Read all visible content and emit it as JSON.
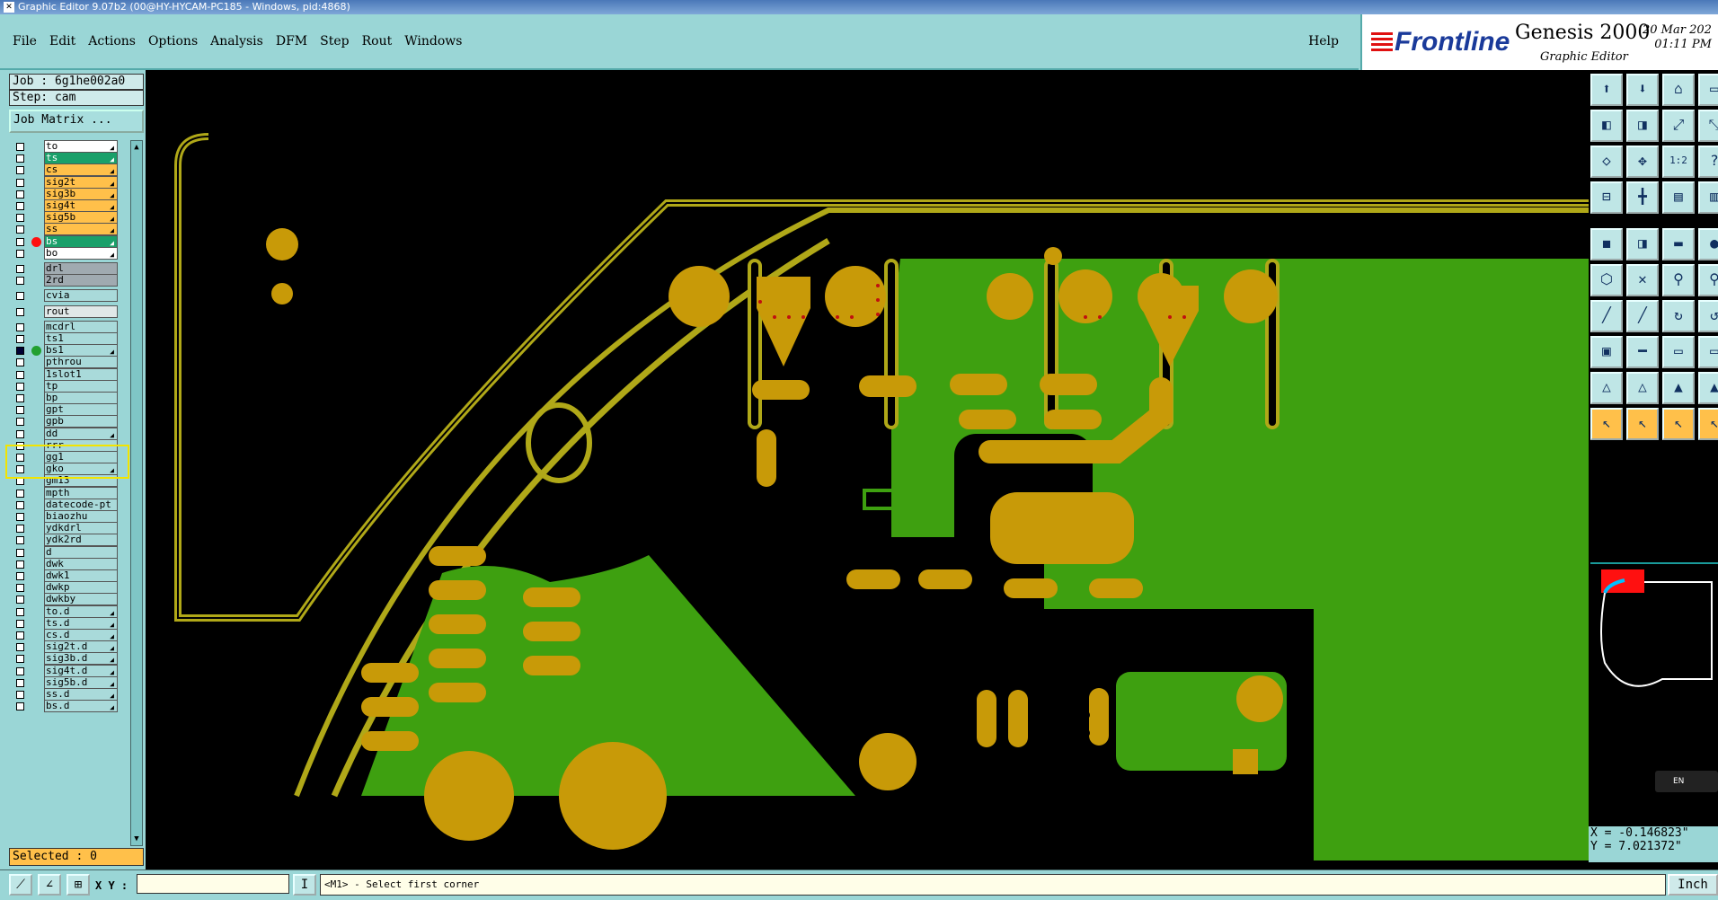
{
  "window": {
    "title": "Graphic Editor 9.07b2 (00@HY-HYCAM-PC185 - Windows, pid:4868)"
  },
  "menu": {
    "items": [
      "File",
      "Edit",
      "Actions",
      "Options",
      "Analysis",
      "DFM",
      "Step",
      "Rout",
      "Windows"
    ],
    "help": "Help"
  },
  "brand": {
    "logo": "Frontline",
    "product": "Genesis 2000",
    "subtitle": "Graphic Editor",
    "date": "20 Mar 202",
    "time": "01:11 PM"
  },
  "job": {
    "job_label": "Job : 6g1he002a0",
    "step_label": "Step: cam",
    "matrix_button": "Job Matrix ..."
  },
  "layers": [
    {
      "name": "to",
      "color": "#ffffff",
      "dot": "",
      "locked": true
    },
    {
      "name": "ts",
      "color": "#1aa06a",
      "dot": "",
      "locked": true
    },
    {
      "name": "cs",
      "color": "#ffc04a",
      "dot": "",
      "locked": true
    },
    {
      "name": "sig2t",
      "color": "#ffc04a",
      "dot": "",
      "locked": true
    },
    {
      "name": "sig3b",
      "color": "#ffc04a",
      "dot": "",
      "locked": true
    },
    {
      "name": "sig4t",
      "color": "#ffc04a",
      "dot": "",
      "locked": true
    },
    {
      "name": "sig5b",
      "color": "#ffc04a",
      "dot": "",
      "locked": true
    },
    {
      "name": "ss",
      "color": "#ffc04a",
      "dot": "",
      "locked": true
    },
    {
      "name": "bs",
      "color": "#1aa06a",
      "dot": "#ff1010",
      "locked": true
    },
    {
      "name": "bo",
      "color": "#ffffff",
      "dot": "",
      "locked": true
    },
    {
      "name": "drl",
      "color": "#a0aab0",
      "dot": "",
      "locked": false
    },
    {
      "name": "2rd",
      "color": "#a0aab0",
      "dot": "",
      "locked": false
    },
    {
      "name": "cvia",
      "color": "#a9dada",
      "dot": "",
      "locked": false
    },
    {
      "name": "rout",
      "color": "#e0e8e8",
      "dot": "",
      "locked": false
    },
    {
      "name": "mcdrl",
      "color": "#a9dada",
      "dot": "",
      "locked": false
    },
    {
      "name": "ts1",
      "color": "#a9dada",
      "dot": "",
      "locked": false
    },
    {
      "name": "bs1",
      "color": "#a9dada",
      "dot": "#22a030",
      "locked": true
    },
    {
      "name": "pthrou",
      "color": "#a9dada",
      "dot": "",
      "locked": false
    },
    {
      "name": "1slot1",
      "color": "#a9dada",
      "dot": "",
      "locked": false
    },
    {
      "name": "tp",
      "color": "#a9dada",
      "dot": "",
      "locked": false
    },
    {
      "name": "bp",
      "color": "#a9dada",
      "dot": "",
      "locked": false
    },
    {
      "name": "gpt",
      "color": "#a9dada",
      "dot": "",
      "locked": false
    },
    {
      "name": "gpb",
      "color": "#a9dada",
      "dot": "",
      "locked": false
    },
    {
      "name": "dd",
      "color": "#a9dada",
      "dot": "",
      "locked": true
    },
    {
      "name": "rrr",
      "color": "#a9dada",
      "dot": "",
      "locked": false
    },
    {
      "name": "gg1",
      "color": "#a9dada",
      "dot": "",
      "locked": false
    },
    {
      "name": "gko",
      "color": "#a9dada",
      "dot": "",
      "locked": true
    },
    {
      "name": "gm13",
      "color": "#a9dada",
      "dot": "",
      "locked": false
    },
    {
      "name": "mpth",
      "color": "#a9dada",
      "dot": "",
      "locked": false
    },
    {
      "name": "datecode-pt",
      "color": "#a9dada",
      "dot": "",
      "locked": false
    },
    {
      "name": "biaozhu",
      "color": "#a9dada",
      "dot": "",
      "locked": false
    },
    {
      "name": "ydkdrl",
      "color": "#a9dada",
      "dot": "",
      "locked": false
    },
    {
      "name": "ydk2rd",
      "color": "#a9dada",
      "dot": "",
      "locked": false
    },
    {
      "name": "d",
      "color": "#a9dada",
      "dot": "",
      "locked": false
    },
    {
      "name": "dwk",
      "color": "#a9dada",
      "dot": "",
      "locked": false
    },
    {
      "name": "dwk1",
      "color": "#a9dada",
      "dot": "",
      "locked": false
    },
    {
      "name": "dwkp",
      "color": "#a9dada",
      "dot": "",
      "locked": false
    },
    {
      "name": "dwkby",
      "color": "#a9dada",
      "dot": "",
      "locked": false
    },
    {
      "name": "to.d",
      "color": "#a9dada",
      "dot": "",
      "locked": true
    },
    {
      "name": "ts.d",
      "color": "#a9dada",
      "dot": "",
      "locked": true
    },
    {
      "name": "cs.d",
      "color": "#a9dada",
      "dot": "",
      "locked": true
    },
    {
      "name": "sig2t.d",
      "color": "#a9dada",
      "dot": "",
      "locked": true
    },
    {
      "name": "sig3b.d",
      "color": "#a9dada",
      "dot": "",
      "locked": true
    },
    {
      "name": "sig4t.d",
      "color": "#a9dada",
      "dot": "",
      "locked": true
    },
    {
      "name": "sig5b.d",
      "color": "#a9dada",
      "dot": "",
      "locked": true
    },
    {
      "name": "ss.d",
      "color": "#a9dada",
      "dot": "",
      "locked": true
    },
    {
      "name": "bs.d",
      "color": "#a9dada",
      "dot": "",
      "locked": true
    }
  ],
  "selected_label": "Selected : 0",
  "toolbar": {
    "icons": [
      "snapshot-icon",
      "window-icon",
      "home-icon",
      "panel-icon",
      "pan-left-icon",
      "pan-right-icon",
      "zoom-box-icon",
      "zoom-fit-icon",
      "fit-all-icon",
      "fit-center-icon",
      "ratio-icon",
      "help-icon",
      "measure-icon",
      "split-icon",
      "layers-icon",
      "layers2-icon",
      "camera-icon",
      "eraser-icon",
      "ruler-icon",
      "dot-icon",
      "node-icon",
      "cross-icon",
      "link-icon",
      "link2-icon",
      "line-icon",
      "line2-icon",
      "arc-icon",
      "arc2-icon",
      "select-box-icon",
      "hline-icon",
      "rect-icon",
      "rect2-icon",
      "triangle-icon",
      "triangle2-icon",
      "triangle3-icon",
      "triangle4-icon",
      "pointer-icon",
      "pointer2-icon",
      "pointer3-icon",
      "pointer4-icon"
    ],
    "ratio_text": "1:2"
  },
  "coords": {
    "x": "X = -0.146823\"",
    "y": "Y = 7.021372\""
  },
  "lang": "EN",
  "status": {
    "xy_label": "X Y :",
    "xy_value": "",
    "prompt": "<M1> - Select first corner",
    "units": "Inch"
  },
  "colors": {
    "board_green": "#3ea010",
    "pad_gold": "#c89a08",
    "outline": "#b0a818",
    "canvas": "#000000",
    "panel": "#9ad6d6"
  }
}
